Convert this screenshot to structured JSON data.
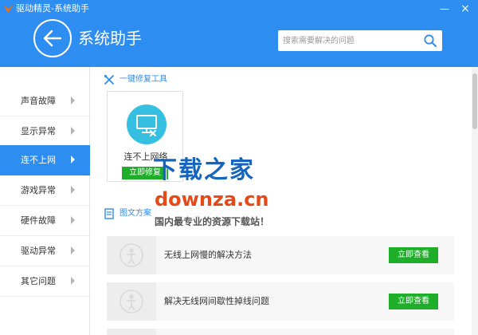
{
  "window": {
    "title": "驱动精灵-系统助手",
    "minimize": "—",
    "close": "×"
  },
  "header": {
    "page_title": "系统助手",
    "search_placeholder": "搜索需要解决的问题"
  },
  "sidebar": {
    "items": [
      {
        "label": "声音故障"
      },
      {
        "label": "显示异常"
      },
      {
        "label": "连不上网",
        "active": true
      },
      {
        "label": "游戏异常"
      },
      {
        "label": "硬件故障"
      },
      {
        "label": "驱动异常"
      },
      {
        "label": "其它问题"
      }
    ]
  },
  "main": {
    "repair_section": "一键修复工具",
    "tool": {
      "label": "连不上网络",
      "button": "立即修复"
    },
    "articles_section": "图文方案",
    "articles": [
      {
        "title": "无线上网慢的解决方法",
        "button": "立即查看"
      },
      {
        "title": "解决无线网间歇性掉线问题",
        "button": "立即查看"
      }
    ]
  },
  "watermark": {
    "line1": "下载之家",
    "line2": "downza.cn",
    "line3": "国内最专业的资源下载站！"
  },
  "colors": {
    "primary": "#2e8df0",
    "button_green": "#1fae2a",
    "tool_icon_bg": "#35bfe0"
  }
}
